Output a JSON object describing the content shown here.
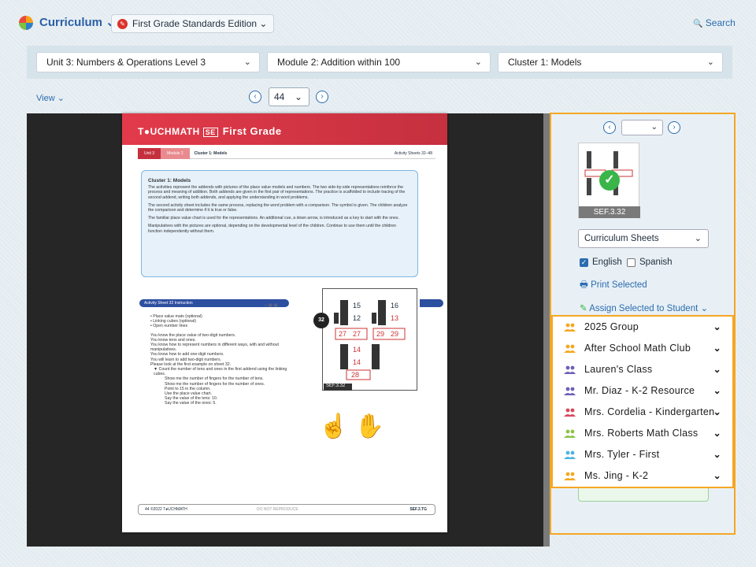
{
  "topbar": {
    "app_label": "Curriculum",
    "app_chevron": "⌄",
    "edition_label": "First Grade Standards Edition",
    "edition_chevron": "⌄",
    "edition_icon": "✎",
    "search_icon": "🔍",
    "search_label": "Search"
  },
  "selectors": {
    "unit": "Unit 3: Numbers & Operations Level 3",
    "module": "Module 2: Addition within 100",
    "cluster": "Cluster 1: Models",
    "chevron": "⌄"
  },
  "viewer": {
    "view_label": "View",
    "view_chevron": "⌄",
    "prev": "‹",
    "next": "›",
    "page_number": "44",
    "page_chevron": "⌄"
  },
  "doc": {
    "brand": "T●UCHMATH",
    "badge": "SE",
    "title": "First Grade",
    "crumb_unit": "Unit 3",
    "crumb_module": "Module 2",
    "crumb_cluster": "Cluster 1: Models",
    "crumb_right": "Activity Sheets 32–48",
    "box_heading": "Cluster 1: Models",
    "box_p1": "The activities represent the addends with pictures of the place value models and numbers. The two side-by-side representations reinforce the process and meaning of addition. Both addends are given in the first pair of representations. The practice is scaffolded to include tracing of the second addend, writing both addends, and applying the understanding in word problems.",
    "box_p2": "The second activity sheet includes the same process, replacing the word problem with a comparison. The symbol is given. The children analyze the comparison and determine if it is true or false.",
    "box_p3": "The familiar place value chart is used for the representations. An additional cue, a down arrow, is introduced as a key to start with the ones.",
    "box_p4": "Manipulatives with the pictures are optional, depending on the developmental level of the children. Continue to use them until the children function independently without them.",
    "activity_bar": "Activity Sheet 32 Instruction",
    "activity_dots": "○⊕⊕",
    "materials": [
      "• Place value mats (optional)",
      "• Linking cubes (optional)",
      "• Open number lines"
    ],
    "talk": [
      "You know the place value of two-digit numbers.",
      "You know tens and ones.",
      "You know how to represent numbers in different ways, with and without manipulatives.",
      "You know how to add one-digit numbers.",
      "You will learn to add two-digit numbers.",
      "Please look at the first example on sheet 32."
    ],
    "steps": [
      "▼ Count the number of tens and ones in the first addend using the linking cubes.",
      "Show me the number of fingers for the number of tens.",
      "Show me the number of fingers for the number of ones.",
      "Point to 15 in the column.",
      "Use the place value chart.",
      "Say the value of the tens: 10.",
      "Say the value of the ones: 5."
    ],
    "sheet_badge": "32",
    "sheet_label": "SEF.3.32",
    "sheet_numbers": [
      "15",
      "16",
      "12",
      "13",
      "27",
      "27",
      "29",
      "29",
      "14",
      "14",
      "28"
    ],
    "hands": "☝ ✋",
    "footer_left": "44  ©2022 T●UCHMATH",
    "footer_mid": "DO NOT REPRODUCE",
    "footer_right": "SEF.3.TG"
  },
  "side": {
    "prev": "‹",
    "next": "›",
    "page_chevron": "⌄",
    "check": "✓",
    "thumb_caption": "SEF.3.32",
    "sheets_dropdown": "Curriculum Sheets",
    "sheets_chevron": "⌄",
    "english_label": "English",
    "spanish_label": "Spanish",
    "checkmark": "✓",
    "print_icon": "🖶",
    "print_label": "Print Selected",
    "assign_icon": "✎",
    "assign_label": "Assign Selected to Student ⌄"
  },
  "groups": [
    {
      "name": "2025 Group",
      "color": "#f4a81f"
    },
    {
      "name": "After School Math Club",
      "color": "#f4a81f"
    },
    {
      "name": "Lauren's Class",
      "color": "#6f5fb8"
    },
    {
      "name": "Mr. Diaz - K-2 Resource",
      "color": "#6f5fb8"
    },
    {
      "name": "Mrs. Cordelia - Kindergarten",
      "color": "#d9475a"
    },
    {
      "name": "Mrs. Roberts Math Class",
      "color": "#8bc34a"
    },
    {
      "name": "Mrs. Tyler - First",
      "color": "#4fb3e0"
    },
    {
      "name": "Ms. Jing - K-2",
      "color": "#f4a81f"
    }
  ],
  "group_chevron": "⌄"
}
